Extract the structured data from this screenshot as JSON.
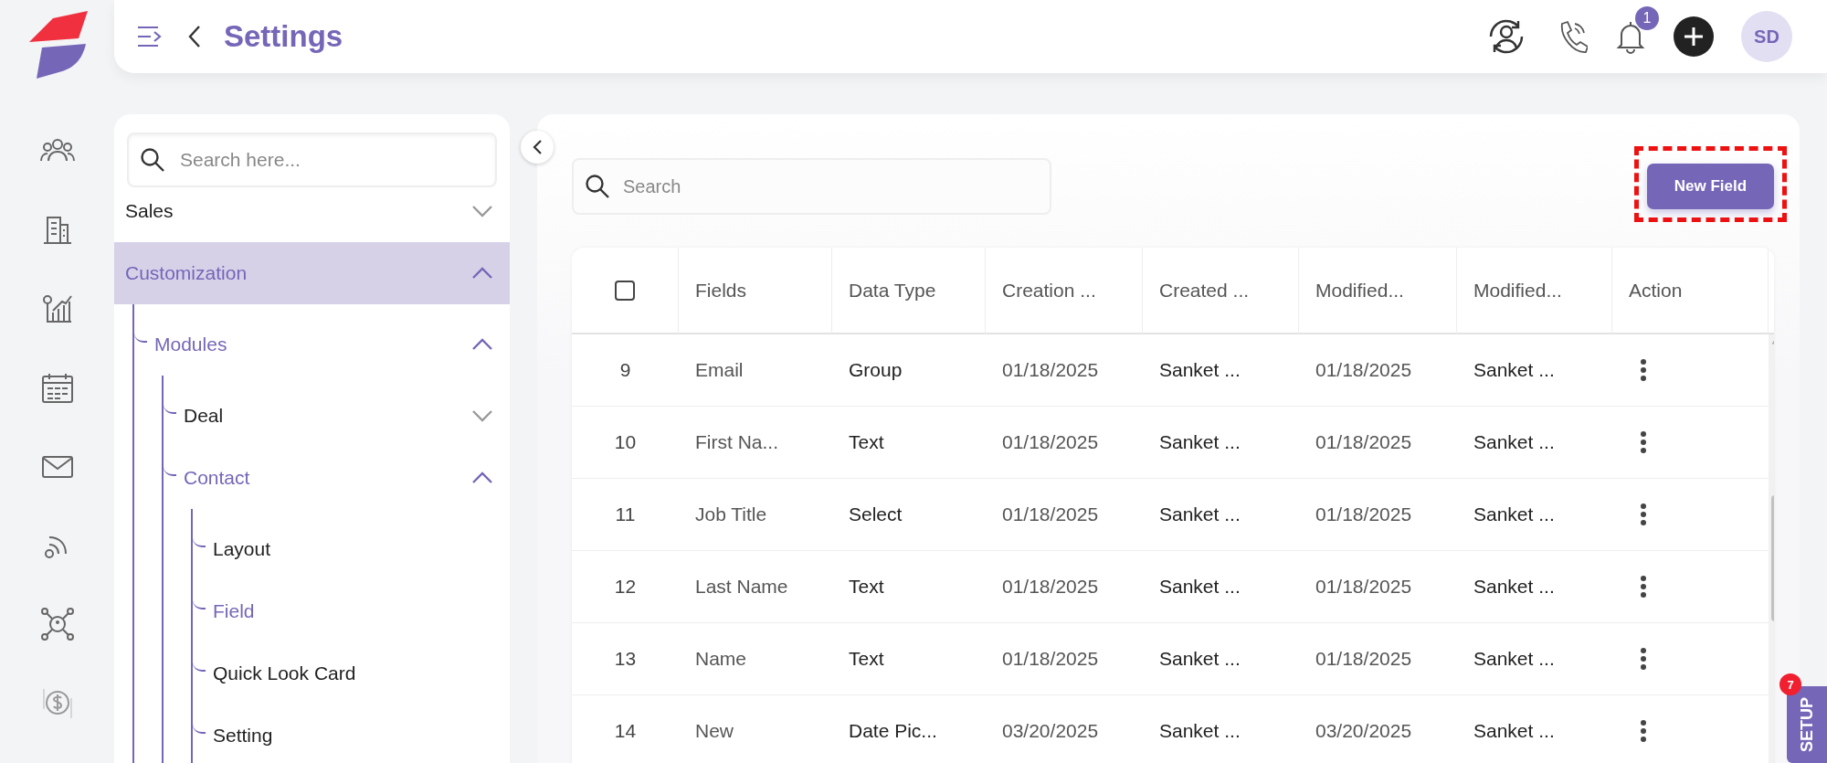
{
  "header": {
    "title": "Settings",
    "notification_count": "1",
    "avatar_initials": "SD"
  },
  "settings_nav": {
    "search": {
      "placeholder": "Search here..."
    },
    "items": [
      {
        "label": "Sales",
        "active": false,
        "expanded": false
      },
      {
        "label": "Customization",
        "active": true,
        "expanded": true,
        "children": [
          {
            "label": "Modules",
            "active": true,
            "expanded": true,
            "children": [
              {
                "label": "Deal",
                "active": false,
                "expanded": false
              },
              {
                "label": "Contact",
                "active": true,
                "expanded": true,
                "children": [
                  {
                    "label": "Layout",
                    "active": false
                  },
                  {
                    "label": "Field",
                    "active": true
                  },
                  {
                    "label": "Quick Look Card",
                    "active": false
                  },
                  {
                    "label": "Setting",
                    "active": false
                  }
                ]
              }
            ]
          }
        ]
      }
    ]
  },
  "main": {
    "search": {
      "placeholder": "Search"
    },
    "new_field_button": "New Field",
    "table": {
      "select_all": {
        "checked": false
      },
      "columns": [
        "Fields",
        "Data Type",
        "Creation ...",
        "Created ...",
        "Modified...",
        "Modified...",
        "Action"
      ],
      "rows": [
        {
          "number": "9",
          "field": "Email",
          "data_type": "Group",
          "creation": "01/18/2025",
          "created_by": "Sanket ...",
          "modified": "01/18/2025",
          "modified_by": "Sanket ..."
        },
        {
          "number": "10",
          "field": "First Na...",
          "data_type": "Text",
          "creation": "01/18/2025",
          "created_by": "Sanket ...",
          "modified": "01/18/2025",
          "modified_by": "Sanket ..."
        },
        {
          "number": "11",
          "field": "Job Title",
          "data_type": "Select",
          "creation": "01/18/2025",
          "created_by": "Sanket ...",
          "modified": "01/18/2025",
          "modified_by": "Sanket ..."
        },
        {
          "number": "12",
          "field": "Last Name",
          "data_type": "Text",
          "creation": "01/18/2025",
          "created_by": "Sanket ...",
          "modified": "01/18/2025",
          "modified_by": "Sanket ..."
        },
        {
          "number": "13",
          "field": "Name",
          "data_type": "Text",
          "creation": "01/18/2025",
          "created_by": "Sanket ...",
          "modified": "01/18/2025",
          "modified_by": "Sanket ..."
        },
        {
          "number": "14",
          "field": "New",
          "data_type": "Date Pic...",
          "creation": "03/20/2025",
          "created_by": "Sanket ...",
          "modified": "03/20/2025",
          "modified_by": "Sanket ..."
        }
      ]
    }
  },
  "setup_tab": {
    "label": "SETUP",
    "badge": "7"
  }
}
